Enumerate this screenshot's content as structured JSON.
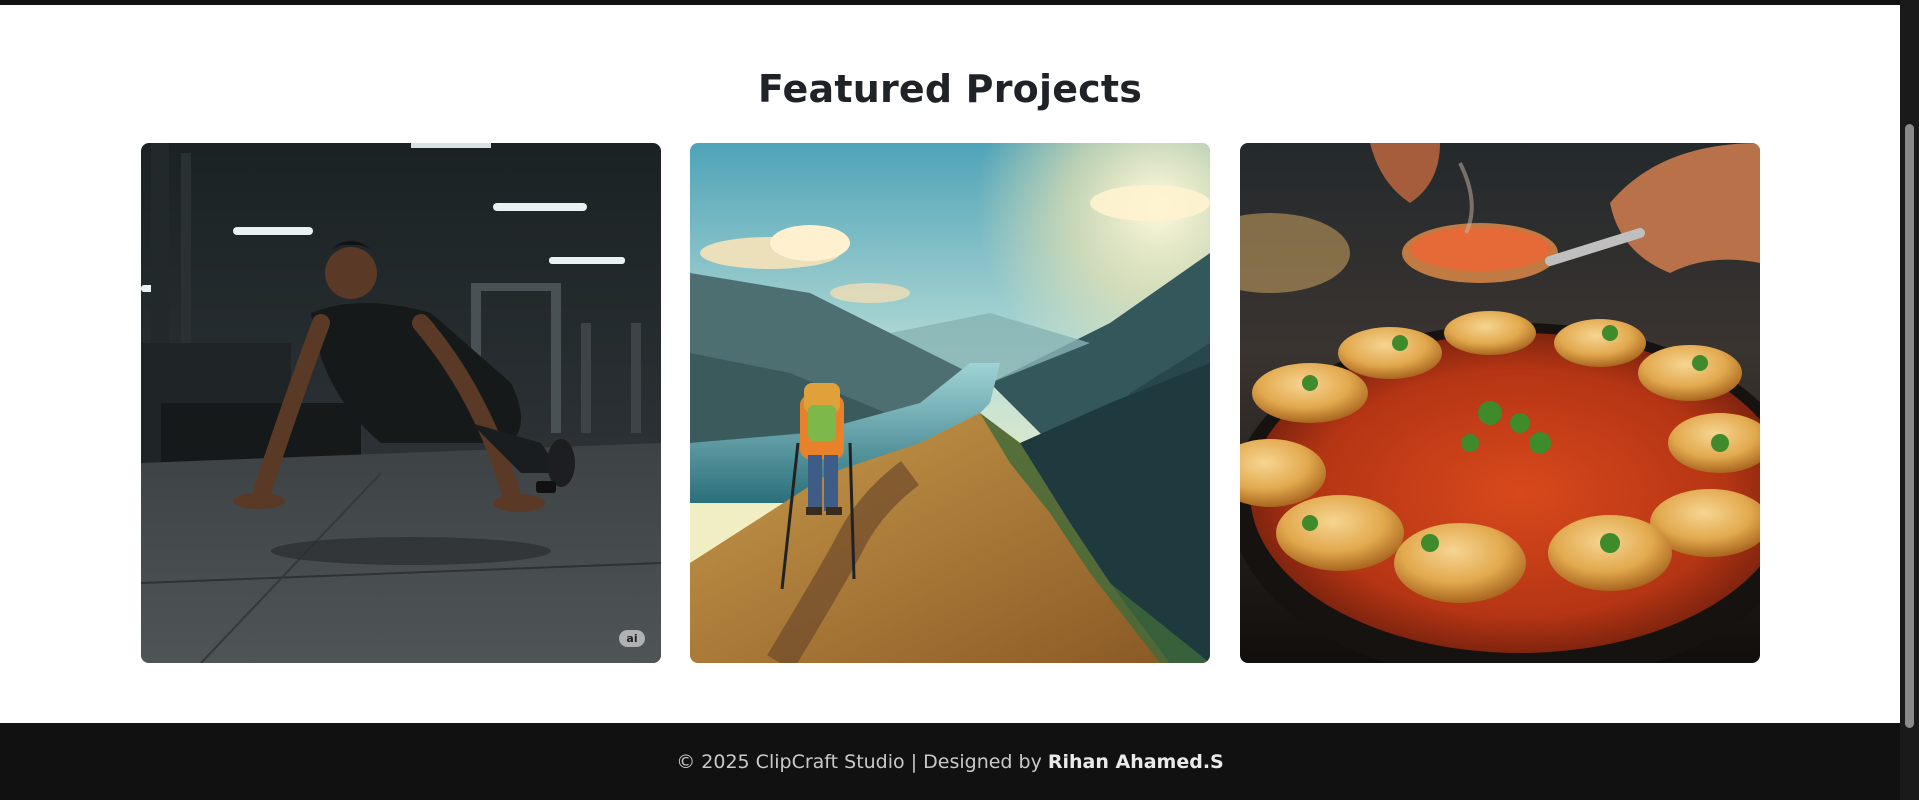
{
  "section": {
    "title": "Featured Projects"
  },
  "projects": [
    {
      "icon": "fitness-photo",
      "badge": "ai"
    },
    {
      "icon": "hiking-landscape-photo"
    },
    {
      "icon": "food-dish-photo"
    }
  ],
  "footer": {
    "copyright": "© 2025 ClipCraft Studio | Designed by",
    "author": "Rihan Ahamed.S"
  },
  "colors": {
    "page_bg": "#ffffff",
    "footer_bg": "#111111",
    "title": "#1f2328"
  }
}
